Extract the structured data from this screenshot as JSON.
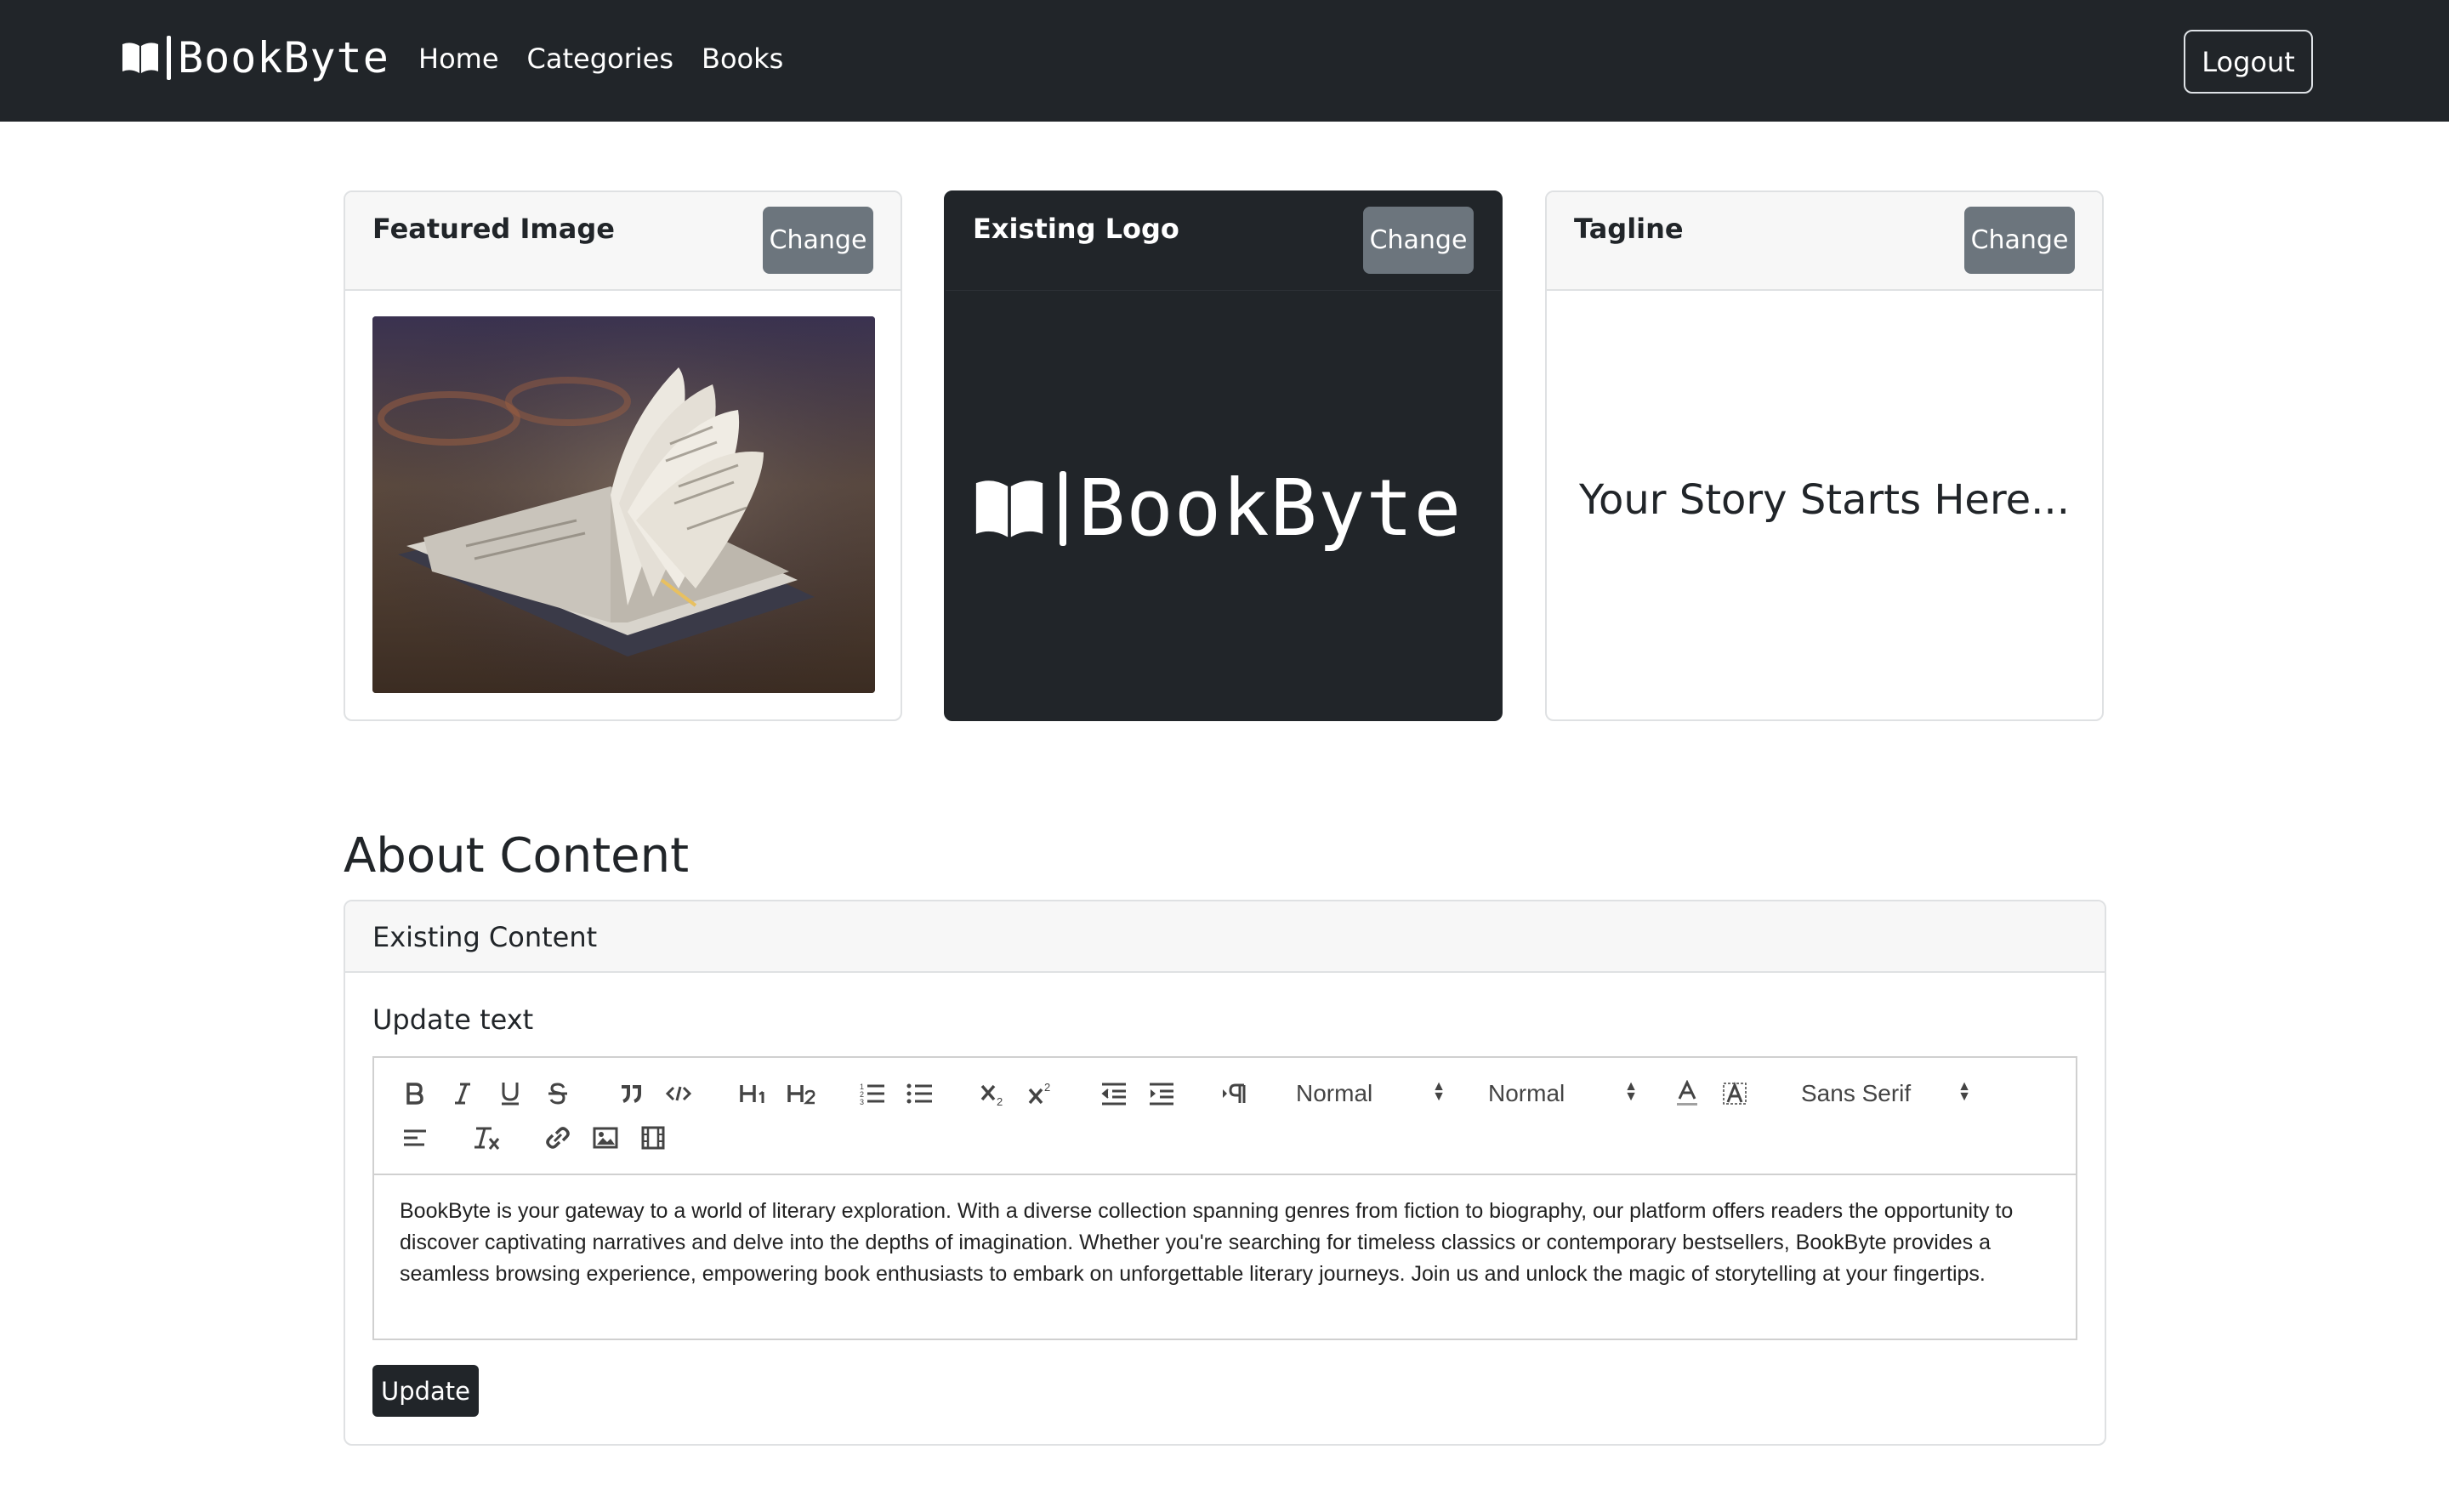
{
  "navbar": {
    "brand": "BookByte",
    "links": [
      "Home",
      "Categories",
      "Books"
    ],
    "logout_label": "Logout"
  },
  "cards": {
    "featured": {
      "title": "Featured Image",
      "change_label": "Change"
    },
    "logo": {
      "title": "Existing Logo",
      "change_label": "Change",
      "logo_text": "BookByte"
    },
    "tagline": {
      "title": "Tagline",
      "change_label": "Change",
      "text": "Your Story Starts Here..."
    }
  },
  "about": {
    "heading": "About Content",
    "header": "Existing Content",
    "label": "Update text",
    "toolbar": {
      "header_select": "Normal",
      "size_select": "Normal",
      "font_select": "Sans Serif"
    },
    "body": "BookByte is your gateway to a world of literary exploration. With a diverse collection spanning genres from fiction to biography, our platform offers readers the opportunity to discover captivating narratives and delve into the depths of imagination. Whether you're searching for timeless classics or contemporary bestsellers, BookByte provides a seamless browsing experience, empowering book enthusiasts to embark on unforgettable literary journeys. Join us and unlock the magic of storytelling at your fingertips.",
    "update_label": "Update"
  },
  "colors": {
    "navbar_bg": "#212529",
    "secondary_button": "#6c757d",
    "card_border": "#dfe1e3"
  },
  "icons": [
    "book-icon",
    "bold-icon",
    "italic-icon",
    "underline-icon",
    "strike-icon",
    "blockquote-icon",
    "code-icon",
    "h1-icon",
    "h2-icon",
    "ordered-list-icon",
    "bullet-list-icon",
    "subscript-icon",
    "superscript-icon",
    "outdent-icon",
    "indent-icon",
    "rtl-direction-icon",
    "text-color-icon",
    "background-color-icon",
    "align-icon",
    "clear-format-icon",
    "link-icon",
    "image-icon",
    "video-icon"
  ]
}
